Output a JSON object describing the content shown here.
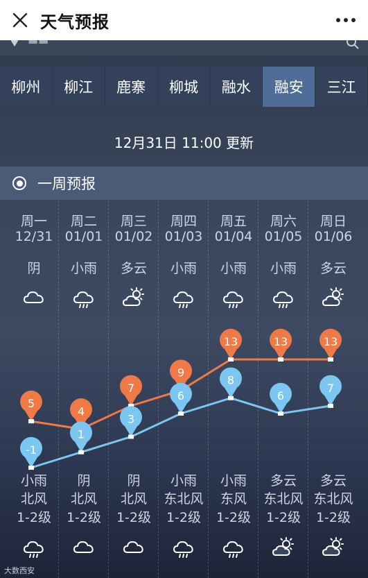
{
  "header": {
    "title": "天气预报",
    "close_icon": "close-icon",
    "more_icon": "more-dots-icon"
  },
  "cities": [
    "柳州",
    "柳江",
    "鹿寨",
    "柳城",
    "融水",
    "融安",
    "三江"
  ],
  "active_city": "融安",
  "update_text": "12月31日 11:00 更新",
  "week_title": "一周预报",
  "days": [
    {
      "day": "周一",
      "date": "12/31",
      "cond": "阴",
      "icon": "cloud-icon",
      "ncond": "小雨",
      "wind": "北风",
      "level": "1-2级",
      "nicon": "rain-icon"
    },
    {
      "day": "周二",
      "date": "01/01",
      "cond": "小雨",
      "icon": "rain-icon",
      "ncond": "阴",
      "wind": "北风",
      "level": "1-2级",
      "nicon": "cloud-icon"
    },
    {
      "day": "周三",
      "date": "01/02",
      "cond": "多云",
      "icon": "partly-cloudy-icon",
      "ncond": "阴",
      "wind": "北风",
      "level": "1-2级",
      "nicon": "cloud-icon"
    },
    {
      "day": "周四",
      "date": "01/03",
      "cond": "小雨",
      "icon": "rain-icon",
      "ncond": "小雨",
      "wind": "东北风",
      "level": "1-2级",
      "nicon": "rain-icon"
    },
    {
      "day": "周五",
      "date": "01/04",
      "cond": "小雨",
      "icon": "rain-icon",
      "ncond": "小雨",
      "wind": "东风",
      "level": "1-2级",
      "nicon": "rain-icon"
    },
    {
      "day": "周六",
      "date": "01/05",
      "cond": "小雨",
      "icon": "rain-icon",
      "ncond": "多云",
      "wind": "东北风",
      "level": "1-2级",
      "nicon": "partly-cloudy-icon"
    },
    {
      "day": "周日",
      "date": "01/06",
      "cond": "多云",
      "icon": "partly-cloudy-icon",
      "ncond": "多云",
      "wind": "东北风",
      "level": "1-2级",
      "nicon": "partly-cloudy-icon"
    }
  ],
  "chart_data": {
    "type": "line",
    "categories": [
      "12/31",
      "01/01",
      "01/02",
      "01/03",
      "01/04",
      "01/05",
      "01/06"
    ],
    "series": [
      {
        "values": [
          5,
          4,
          7,
          9,
          13,
          13,
          13
        ],
        "color": "#f07a45"
      },
      {
        "values": [
          -1,
          1,
          3,
          6,
          8,
          6,
          7
        ],
        "color": "#7cc6f2"
      }
    ]
  },
  "watermark": "大数西安"
}
